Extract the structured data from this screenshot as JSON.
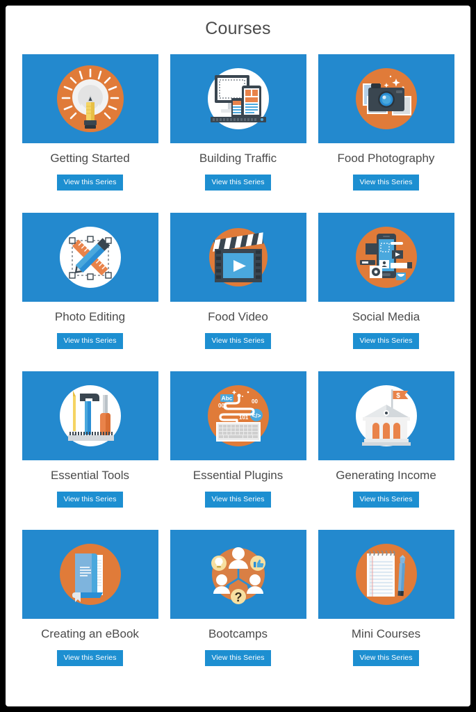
{
  "page": {
    "title": "Courses",
    "accent_blue": "#2389ce",
    "button_blue": "#1d8fd1",
    "accent_orange": "#e07b39",
    "title_color": "#4a4a4a",
    "background": "#ffffff",
    "frame_color": "#000000"
  },
  "button_label": "View this Series",
  "icon_text": {
    "abc": "Abc",
    "bin001": "001",
    "bin00": "00",
    "bin101": "101",
    "code": "</>",
    "dollar": "$",
    "question": "?"
  },
  "courses": [
    {
      "title": "Getting Started",
      "icon": "lightbulb-pencil-icon",
      "circle": "orange",
      "button": "View this Series"
    },
    {
      "title": "Building Traffic",
      "icon": "responsive-devices-icon",
      "circle": "white",
      "button": "View this Series"
    },
    {
      "title": "Food Photography",
      "icon": "camera-photos-icon",
      "circle": "orange",
      "button": "View this Series"
    },
    {
      "title": "Photo Editing",
      "icon": "pencil-ruler-icon",
      "circle": "white",
      "button": "View this Series"
    },
    {
      "title": "Food Video",
      "icon": "clapperboard-play-icon",
      "circle": "orange",
      "button": "View this Series"
    },
    {
      "title": "Social Media",
      "icon": "smartphone-social-icon",
      "circle": "orange",
      "button": "View this Series"
    },
    {
      "title": "Essential Tools",
      "icon": "hammer-tools-icon",
      "circle": "white",
      "button": "View this Series"
    },
    {
      "title": "Essential Plugins",
      "icon": "keyboard-code-icon",
      "circle": "orange",
      "button": "View this Series"
    },
    {
      "title": "Generating Income",
      "icon": "bank-flag-icon",
      "circle": "white",
      "button": "View this Series"
    },
    {
      "title": "Creating an eBook",
      "icon": "book-icon",
      "circle": "orange",
      "button": "View this Series"
    },
    {
      "title": "Bootcamps",
      "icon": "people-group-icon",
      "circle": "orange",
      "button": "View this Series"
    },
    {
      "title": "Mini Courses",
      "icon": "notepad-pencil-icon",
      "circle": "orange",
      "button": "View this Series"
    }
  ]
}
